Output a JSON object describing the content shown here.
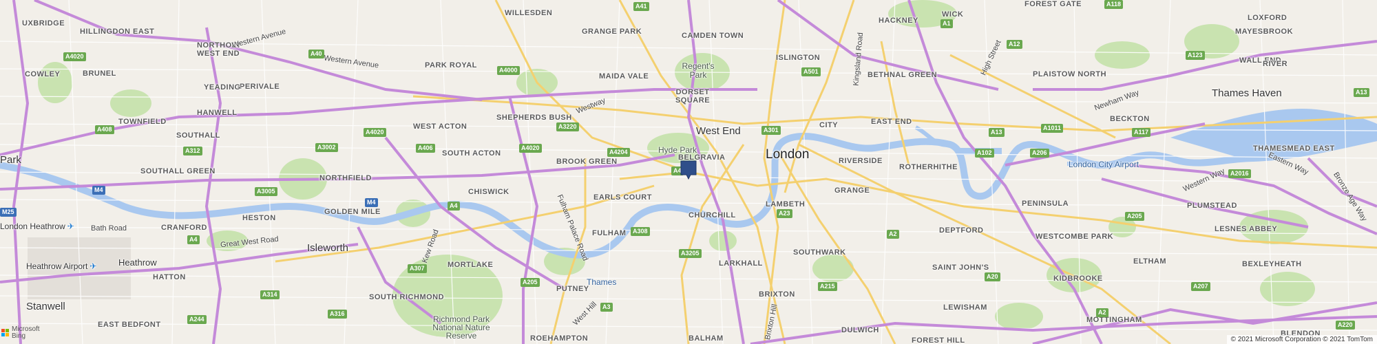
{
  "map": {
    "colors": {
      "land": "#f2efe9",
      "park": "#c9e3b0",
      "water": "#a9c8ef",
      "motorway": "#c48ad9",
      "primary": "#f4d06f",
      "secondary": "#ffffff",
      "pin": "#2f4f8a"
    },
    "labels": {
      "uxbridge": "UXBRIDGE",
      "hillingdon_east": "HILLINGDON EAST",
      "northolt_west_end": "NORTHOLT",
      "west_end_n": "WEST END",
      "perivale": "PERIVALE",
      "willesden": "WILLESDEN",
      "grange_park": "GRANGE PARK",
      "camden_town": "CAMDEN TOWN",
      "hackney": "HACKNEY",
      "wick": "WICK",
      "forest_gate": "FOREST GATE",
      "loxford": "LOXFORD",
      "mayesbrook": "MAYESBROOK",
      "cowley": "COWLEY",
      "brunel": "BRUNEL",
      "yeading": "YEADING",
      "park_royal": "PARK ROYAL",
      "maida_vale": "MAIDA VALE",
      "regents_park": "Regent's Park",
      "islington": "ISLINGTON",
      "bethnal_green": "BETHNAL GREEN",
      "plaistow_north": "PLAISTOW NORTH",
      "wall_end": "WALL END",
      "river": "RIVER",
      "thames_haven": "Thames Haven",
      "hanwell": "HANWELL",
      "dorset_square": "DORSET SQUARE",
      "townfield": "TOWNFIELD",
      "shepherds_bush": "SHEPHERDS BUSH",
      "east_end": "EAST END",
      "beckton": "BECKTON",
      "southall": "SOUTHALL",
      "west_acton": "WEST ACTON",
      "west_end": "West End",
      "city_lbl": "CITY",
      "hyde_park": "Hyde Park",
      "london": "London",
      "belgravia": "BELGRAVIA",
      "riverside": "RIVERSIDE",
      "thamesmead_east": "THAMESMEAD EAST",
      "park": "Park",
      "south_acton": "SOUTH ACTON",
      "brook_green": "BROOK GREEN",
      "rotherhithe": "ROTHERHITHE",
      "london_city_airport": "London City Airport",
      "southall_green": "SOUTHALL GREEN",
      "northfield": "NORTHFIELD",
      "chiswick": "CHISWICK",
      "grange": "GRANGE",
      "earls_court": "EARLS COURT",
      "lambeth": "LAMBETH",
      "golden_mile": "GOLDEN MILE",
      "churchill": "CHURCHILL",
      "peninsula": "PENINSULA",
      "plumstead": "PLUMSTEAD",
      "heston": "HESTON",
      "fulham": "FULHAM",
      "london_heathrow": "London Heathrow",
      "cranford": "CRANFORD",
      "deptford": "DEPTFORD",
      "westcombe_park": "WESTCOMBE PARK",
      "lesnes_abbey": "LESNES ABBEY",
      "isleworth": "Isleworth",
      "larkhall": "LARKHALL",
      "southwark": "SOUTHWARK",
      "heathrow_airport": "Heathrow Airport",
      "heathrow": "Heathrow",
      "eltham": "ELTHAM",
      "bexleyheath": "BEXLEYHEATH",
      "mortlake": "MORTLAKE",
      "saint_johns": "SAINT JOHN'S",
      "hatton": "HATTON",
      "kidbrooke": "KIDBROOKE",
      "thames": "Thames",
      "putney": "PUTNEY",
      "stanwell": "Stanwell",
      "south_richmond": "SOUTH RICHMOND",
      "brixton": "BRIXTON",
      "lewisham": "LEWISHAM",
      "richmond_park": "Richmond Park National Nature Reserve",
      "mottingham": "MOTTINGHAM",
      "east_bedfont": "EAST BEDFONT",
      "roehampton": "ROEHAMPTON",
      "balham": "BALHAM",
      "dulwich": "DULWICH",
      "forest_hill": "FOREST HILL",
      "blendon": "BLENDON"
    },
    "road_names": {
      "western_avenue": "Western Avenue",
      "westway": "Westway",
      "great_west_road": "Great West Road",
      "bath_road": "Bath Road",
      "kew_road": "Kew Road",
      "fulham_palace_road": "Fulham Palace Road",
      "west_hill": "West Hill",
      "brixton_hill": "Brixton Hill",
      "kingsland_road": "Kingsland Road",
      "high_street": "High Street",
      "newham_way": "Newham Way",
      "eastern_way": "Eastern Way",
      "western_way": "Western Way",
      "bronze_age_way": "Bronze Age Way"
    },
    "shields": [
      "A41",
      "A4020",
      "A40",
      "A4000",
      "A408",
      "A3220",
      "A4020",
      "A3002",
      "A312",
      "A4020",
      "A406",
      "A4204",
      "A4",
      "A3005",
      "M4",
      "M4",
      "A4",
      "A3",
      "A308",
      "A23",
      "A205",
      "A307",
      "A3205",
      "A314",
      "A244",
      "A316",
      "A3",
      "A205",
      "A215",
      "A2",
      "A20",
      "A2",
      "A205",
      "A102",
      "A206",
      "A13",
      "A117",
      "A1011",
      "A12",
      "A1",
      "A118",
      "A123",
      "A13",
      "A2016",
      "A207",
      "A220",
      "A501",
      "A301",
      "A3",
      "A1",
      "M25",
      "A4"
    ],
    "pin_label": "Selected location",
    "bing": {
      "line1": "Microsoft",
      "line2": "Bing"
    },
    "attribution": "© 2021 Microsoft Corporation © 2021 TomTom"
  }
}
